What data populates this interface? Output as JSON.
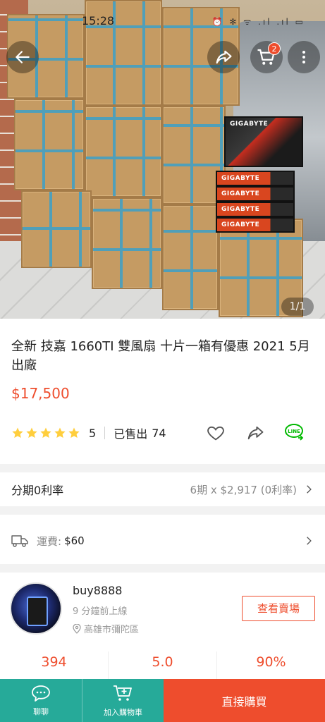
{
  "status_bar": {
    "time": "15:28",
    "icons": "⏰ ✻ ᯤ .ıl .ıl ▭"
  },
  "header": {
    "cart_count": "2",
    "image_counter": "1/1"
  },
  "product": {
    "title": "全新 技嘉 1660TI 雙風扇  十片一箱有優惠 2021 5月出廠",
    "price": "$17,500",
    "rating": "5",
    "sold_label": "已售出",
    "sold_count": "74"
  },
  "installment": {
    "label": "分期0利率",
    "value": "6期 x $2,917 (0利率)"
  },
  "shipping": {
    "label": "運費:",
    "value": "$60"
  },
  "seller": {
    "name": "buy8888",
    "online": "9 分鐘前上線",
    "location": "高雄市彌陀區",
    "view_shop": "查看賣場",
    "stats": [
      "394",
      "5.0",
      "90%"
    ]
  },
  "bottom_bar": {
    "chat": "聊聊",
    "add_to_cart": "加入購物車",
    "buy_now": "直接購買"
  },
  "colors": {
    "accent": "#ee4d2d",
    "teal": "#26aa99",
    "line_green": "#00b900",
    "star": "#ffce3d"
  },
  "icons": [
    "back-arrow-icon",
    "share-icon",
    "cart-icon",
    "more-vertical-icon",
    "heart-icon",
    "line-icon",
    "truck-icon",
    "location-pin-icon",
    "chat-icon",
    "add-cart-icon",
    "chevron-right-icon"
  ]
}
